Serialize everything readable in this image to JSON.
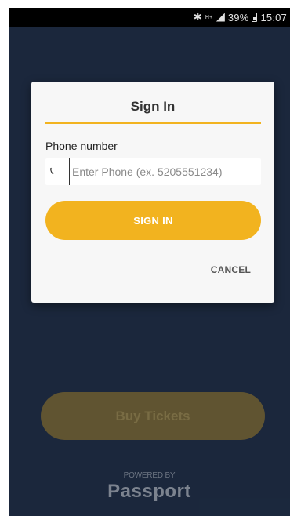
{
  "status_bar": {
    "bluetooth_icon": "bluetooth-icon",
    "network": "H+",
    "battery": "39%",
    "time": "15:07"
  },
  "dialog": {
    "title": "Sign In",
    "phone_label": "Phone number",
    "phone_placeholder": "Enter Phone (ex. 5205551234)",
    "phone_value": "",
    "phone_icon": "phone-icon",
    "signin_label": "SIGN IN",
    "cancel_label": "CANCEL"
  },
  "main": {
    "buy_tickets_label": "Buy Tickets",
    "powered_by": "POWERED BY",
    "brand": "Passport"
  },
  "colors": {
    "background": "#1f2d45",
    "accent": "#f2b31f",
    "dialog_bg": "#f7f7f7"
  }
}
